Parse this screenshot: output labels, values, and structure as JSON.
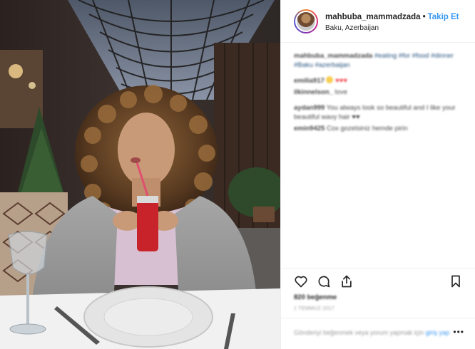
{
  "post": {
    "username": "mahbuba_mammadzada",
    "separator": "•",
    "follow_label": "Takip Et",
    "location": "Baku, Azerbaijan"
  },
  "comments": [
    {
      "user": "mahbuba_mammadzada",
      "text": "#eating #for #food #dinner #Baku #azerbaijan"
    },
    {
      "user": "emilia917",
      "text": "♥♥♥"
    },
    {
      "user": "ilkinnelson_",
      "text": "love"
    },
    {
      "user": "aydan999",
      "text": "You always look so beautiful and I like your beautiful wavy hair ♥♥"
    },
    {
      "user": "emin9425",
      "text": "Cox gozelsiniz hemde pirin"
    }
  ],
  "actions": {
    "like_icon": "heart-icon",
    "comment_icon": "comment-icon",
    "share_icon": "share-icon",
    "save_icon": "bookmark-icon"
  },
  "likes_text": "820 beğenme",
  "date_text": "1 TEMMUZ 2017",
  "add_comment": {
    "placeholder": "Gönderiyi beğenmek veya yorum yapmak için",
    "link": "giriş yap",
    "more_label": "•••"
  },
  "colors": {
    "accent": "#3897f0",
    "heart": "#ed1c24",
    "border": "#efefef"
  }
}
